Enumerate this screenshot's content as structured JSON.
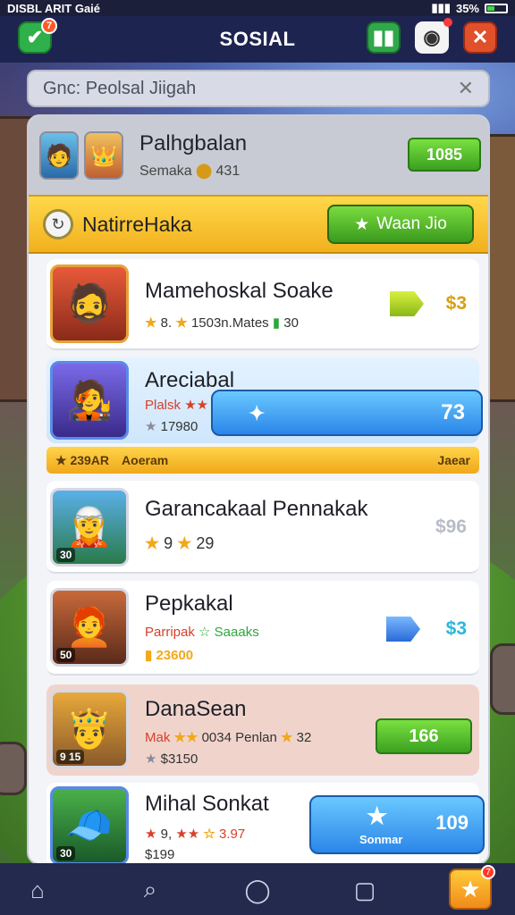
{
  "status_bar": {
    "left": "DISBL ARIT Gaié",
    "battery": "35%"
  },
  "top_bar": {
    "title": "SOSIAL",
    "check_badge": "7"
  },
  "search": {
    "placeholder": "Gnc: Peolsal Jiigah"
  },
  "header": {
    "title": "Palhgbalan",
    "subtitle": "Semaka",
    "subtitle_value": "431",
    "button_value": "1085"
  },
  "banner": {
    "title": "NatirreHaka",
    "button_label": "Waan Jio"
  },
  "players": [
    {
      "name": "Mamehoskal Soake",
      "meta_a": "8.",
      "meta_b": "1503n.Mates",
      "meta_c": "30",
      "price": "$3"
    },
    {
      "name": "Areciabal",
      "meta_a": "Plalsk",
      "meta_b": "17980",
      "button_value": "73",
      "strip_left": "239AR",
      "strip_mid": "Aoeram",
      "strip_right": "Jaear"
    },
    {
      "name": "Garancakaal Pennakak",
      "meta_a": "9",
      "meta_b": "29",
      "level": "30",
      "price": "$96"
    },
    {
      "name": "Pepkakal",
      "meta_a": "Parripak",
      "meta_b": "Saaaks",
      "meta_c": "23600",
      "level": "50",
      "price": "$3"
    },
    {
      "name": "DanaSean",
      "meta_a": "Mak",
      "meta_b": "0034 Penlan",
      "meta_c": "32",
      "meta_d": "$3150",
      "level": "9 15",
      "button_value": "166"
    },
    {
      "name": "Mihal Sonkat",
      "meta_a": "9,",
      "meta_b": "3.97",
      "meta_c": "$199",
      "button_value": "109",
      "button_label": "Sonmar",
      "level": "30"
    }
  ],
  "nav": {
    "fav_badge": "7"
  },
  "colors": {
    "accent_green": "#3aa020",
    "accent_yellow": "#f2b01e",
    "accent_blue": "#2a86e8"
  }
}
